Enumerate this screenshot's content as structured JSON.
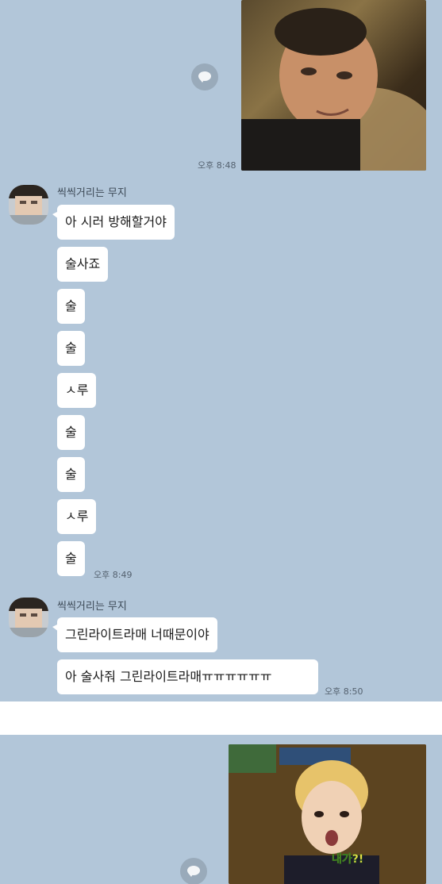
{
  "chat": {
    "photo_time_1": "오후 8:48",
    "group1": {
      "sender": "씩씩거리는 무지",
      "messages": [
        "아 시러 방해할거야",
        "술사죠",
        "술",
        "술",
        "ㅅ루",
        "술",
        "술",
        "ㅅ루",
        "술"
      ],
      "time": "오후 8:49"
    },
    "group2": {
      "sender": "씩씩거리는 무지",
      "messages": [
        "그린라이트라매 너때문이야",
        "아 술사줘 그린라이트라매ㅠㅠㅠㅠㅠㅠ"
      ],
      "time": "오후 8:50"
    },
    "photo2_caption": "내가?!"
  },
  "icons": {
    "share": "share-speech-bubble-icon",
    "avatar": "pixelated-avatar"
  },
  "colors": {
    "chat_background": "#b2c6d9",
    "bubble": "#ffffff"
  }
}
